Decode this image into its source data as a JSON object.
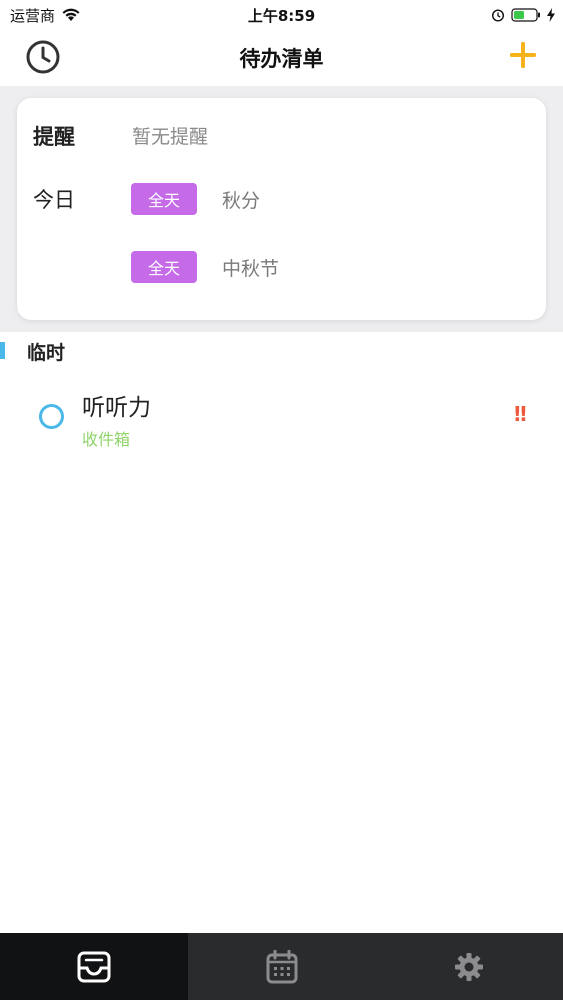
{
  "status_bar": {
    "carrier": "运营商",
    "time": "上午8:59"
  },
  "nav": {
    "title": "待办清单",
    "left_icon": "clock-icon",
    "right_icon": "plus-icon",
    "accent_color": "#f5b21b"
  },
  "summary": {
    "reminder_label": "提醒",
    "reminder_value": "暂无提醒",
    "today_label": "今日",
    "events": [
      {
        "tag": "全天",
        "name": "秋分"
      },
      {
        "tag": "全天",
        "name": "中秋节"
      }
    ],
    "tag_color": "#c56be8"
  },
  "section": {
    "title": "临时",
    "bar_color": "#4ab8e8"
  },
  "tasks": [
    {
      "title": "听听力",
      "list": "收件箱",
      "priority": "!!",
      "priority_color": "#ec5a3b",
      "list_color": "#8fd46a"
    }
  ],
  "tab_bar": {
    "tabs": [
      {
        "icon": "inbox-icon",
        "active": true
      },
      {
        "icon": "calendar-icon",
        "active": false
      },
      {
        "icon": "gear-icon",
        "active": false
      }
    ]
  }
}
